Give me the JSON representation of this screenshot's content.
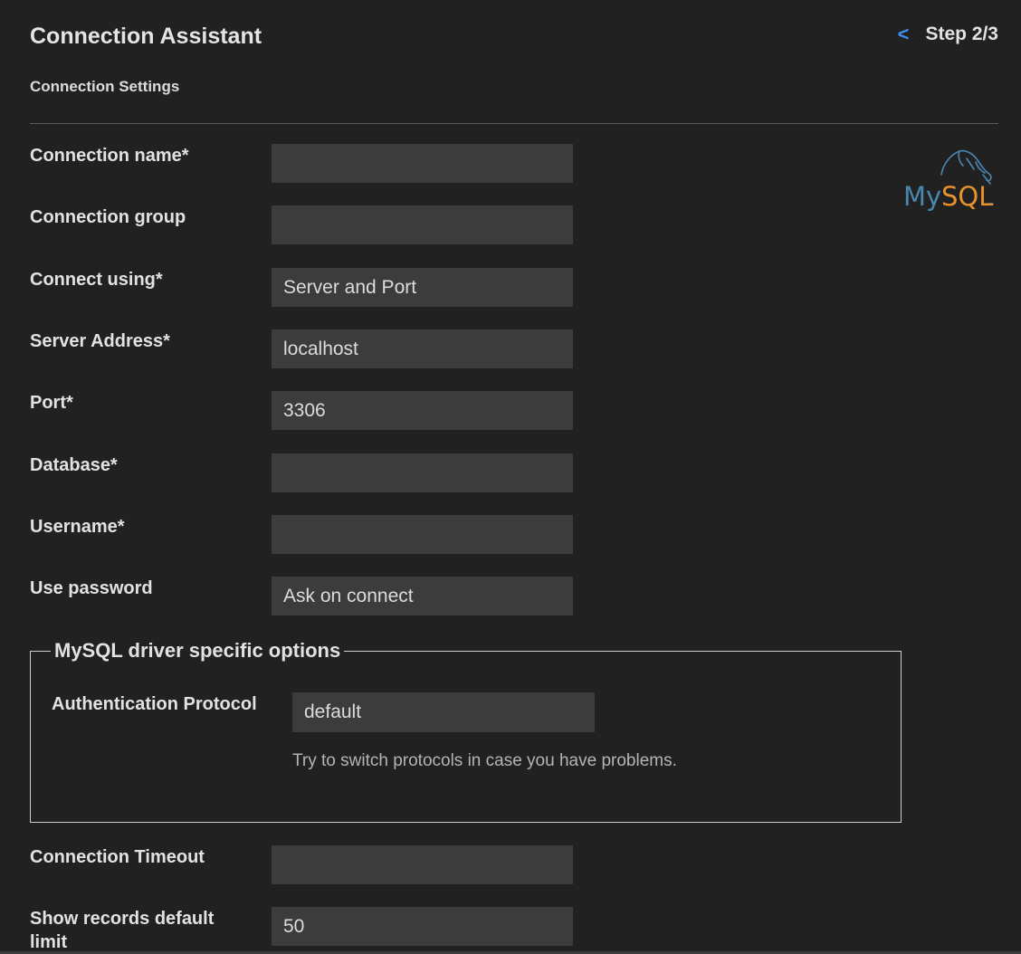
{
  "header": {
    "title": "Connection Assistant",
    "back_glyph": "<",
    "step": "Step 2/3",
    "subtitle": "Connection Settings"
  },
  "logo": {
    "text_my": "My",
    "text_sql": "SQL",
    "tm": "™",
    "colors": {
      "my": "#4a87b0",
      "sql": "#e8922b",
      "dolphin": "#4a87b0"
    }
  },
  "form": {
    "connection_name": {
      "label": "Connection name*",
      "value": ""
    },
    "connection_group": {
      "label": "Connection group",
      "value": ""
    },
    "connect_using": {
      "label": "Connect using*",
      "value": "Server and Port"
    },
    "server_address": {
      "label": "Server Address*",
      "value": "localhost"
    },
    "port": {
      "label": "Port*",
      "value": "3306"
    },
    "database": {
      "label": "Database*",
      "value": ""
    },
    "username": {
      "label": "Username*",
      "value": ""
    },
    "use_password": {
      "label": "Use password",
      "value": "Ask on connect"
    }
  },
  "driver_options": {
    "legend": "MySQL driver specific options",
    "auth_protocol": {
      "label": "Authentication Protocol",
      "value": "default"
    },
    "hint": "Try to switch protocols in case you have problems."
  },
  "advanced": {
    "connection_timeout": {
      "label": "Connection Timeout",
      "value": ""
    },
    "show_records_limit": {
      "label": "Show records default limit",
      "value": "50"
    }
  },
  "colors": {
    "background": "#212121",
    "input_background": "#3c3c3c",
    "accent": "#3b8eea"
  }
}
